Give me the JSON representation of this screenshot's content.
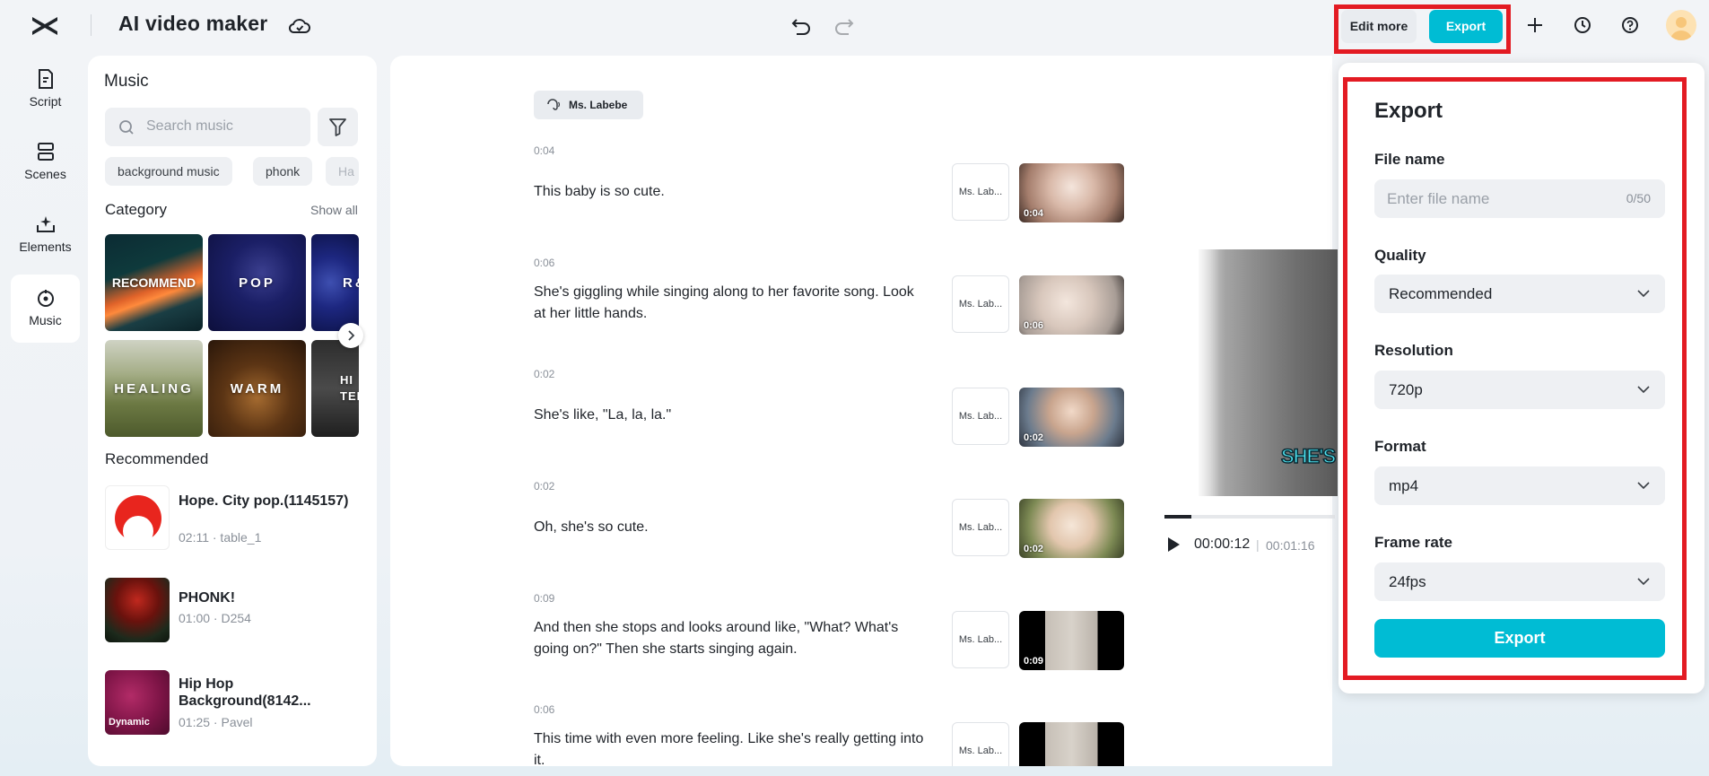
{
  "app": {
    "title": "AI video maker",
    "logo_icon": "capcut-logo-icon",
    "cloud_icon": "cloud-sync-icon"
  },
  "toolbar": {
    "undo_icon": "undo-icon",
    "redo_icon": "redo-icon",
    "edit_more_label": "Edit more",
    "export_label": "Export",
    "plus_icon": "plus-icon",
    "history_icon": "history-icon",
    "help_icon": "help-icon"
  },
  "nav": [
    {
      "label": "Script",
      "icon": "script-icon"
    },
    {
      "label": "Scenes",
      "icon": "scenes-icon"
    },
    {
      "label": "Elements",
      "icon": "elements-icon"
    },
    {
      "label": "Music",
      "icon": "music-icon",
      "active": true
    }
  ],
  "music": {
    "title": "Music",
    "search_placeholder": "Search music",
    "tags": [
      "background music",
      "phonk",
      "Ha"
    ],
    "category_title": "Category",
    "show_all": "Show all",
    "categories": [
      "RECOMMEND",
      "POP",
      "R&",
      "HEALING",
      "WARM",
      "HI TEM"
    ],
    "recommended_title": "Recommended",
    "tracks": [
      {
        "name": "Hope. City pop.(1145157)",
        "meta": "02:11 · table_1"
      },
      {
        "name": "PHONK!",
        "meta": "01:00 · D254"
      },
      {
        "name": "Hip Hop Background(8142...",
        "meta": "01:25 · Pavel",
        "thumb_label": "Dynamic"
      }
    ]
  },
  "script": {
    "voice_name": "Ms. Labebe",
    "segments": [
      {
        "time": "0:04",
        "text": "This baby is so cute.",
        "voice": "Ms. Lab...",
        "clip_duration": "0:04"
      },
      {
        "time": "0:06",
        "text": "She's giggling while singing along to her favorite song. Look at her little hands.",
        "voice": "Ms. Lab...",
        "clip_duration": "0:06"
      },
      {
        "time": "0:02",
        "text": "She's like, \"La, la, la.\"",
        "voice": "Ms. Lab...",
        "clip_duration": "0:02"
      },
      {
        "time": "0:02",
        "text": "Oh, she's so cute.",
        "voice": "Ms. Lab...",
        "clip_duration": "0:02"
      },
      {
        "time": "0:09",
        "text": "And then she stops and looks around like, \"What? What's going on?\" Then she starts singing again.",
        "voice": "Ms. Lab...",
        "clip_duration": "0:09"
      },
      {
        "time": "0:06",
        "text": "This time with even more feeling. Like she's really getting into it.",
        "voice": "Ms. Lab...",
        "clip_duration": ""
      }
    ]
  },
  "preview": {
    "caption": "SHE'S",
    "current_time": "00:00:12",
    "separator": "|",
    "total_time": "00:01:16",
    "progress_fraction": 0.16
  },
  "export_panel": {
    "title": "Export",
    "file_name_label": "File name",
    "file_name_placeholder": "Enter file name",
    "file_name_value": "",
    "file_name_count": "0/50",
    "quality_label": "Quality",
    "quality_value": "Recommended",
    "resolution_label": "Resolution",
    "resolution_value": "720p",
    "format_label": "Format",
    "format_value": "mp4",
    "frame_rate_label": "Frame rate",
    "frame_rate_value": "24fps",
    "export_button": "Export"
  },
  "colors": {
    "accent": "#00bcd4",
    "highlight": "#e31b23"
  }
}
